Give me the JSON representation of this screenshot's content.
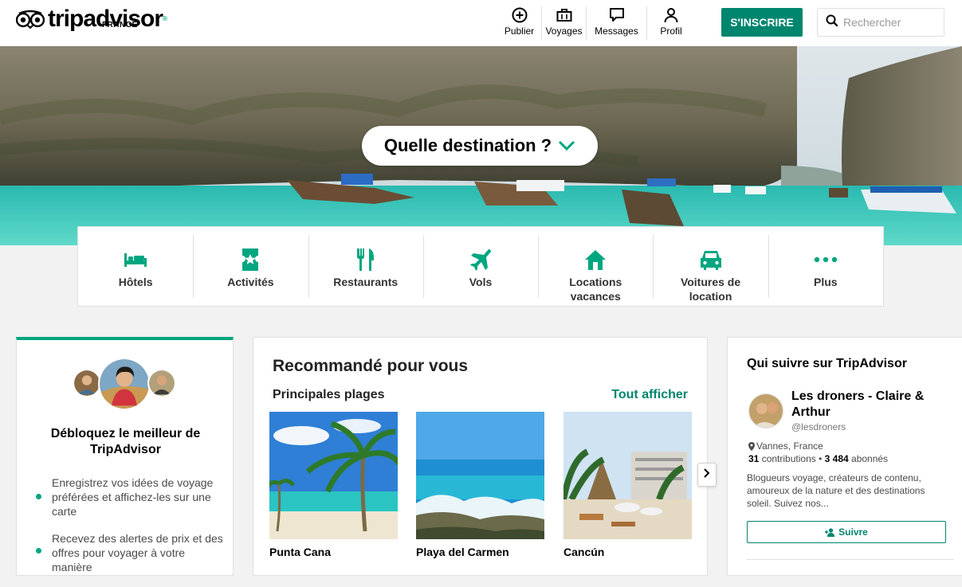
{
  "brand": {
    "name": "tripadvisor",
    "registered": "®",
    "country": "FRANCE",
    "accent": "#00a680",
    "button_color": "#00856f"
  },
  "nav": {
    "publish": "Publier",
    "trips": "Voyages",
    "messages": "Messages",
    "profile": "Profil",
    "signup": "S'INSCRIRE",
    "search_placeholder": "Rechercher"
  },
  "hero": {
    "prompt": "Quelle destination ?"
  },
  "categories": [
    {
      "label": "Hôtels",
      "icon": "bed-icon"
    },
    {
      "label": "Activités",
      "icon": "ticket-icon"
    },
    {
      "label": "Restaurants",
      "icon": "fork-knife-icon"
    },
    {
      "label": "Vols",
      "icon": "plane-icon"
    },
    {
      "label": "Locations vacances",
      "icon": "house-icon"
    },
    {
      "label": "Voitures de location",
      "icon": "car-icon"
    },
    {
      "label": "Plus",
      "icon": "more-icon"
    }
  ],
  "unlock": {
    "title": "Débloquez le meilleur de TripAdvisor",
    "benefits": [
      "Enregistrez vos idées de voyage préférées et affichez-les sur une carte",
      "Recevez des alertes de prix et des offres pour voyager à votre manière"
    ]
  },
  "recommended": {
    "title": "Recommandé pour vous",
    "subtitle": "Principales plages",
    "see_all": "Tout afficher",
    "beaches": [
      {
        "name": "Punta Cana"
      },
      {
        "name": "Playa del Carmen"
      },
      {
        "name": "Cancún"
      }
    ]
  },
  "follow": {
    "title": "Qui suivre sur TripAdvisor",
    "profile": {
      "name": "Les droners - Claire & Arthur",
      "handle": "@lesdroners",
      "location": "Vannes, France",
      "contributions": "31",
      "contributions_label": "contributions",
      "separator": "•",
      "followers": "3 484",
      "followers_label": "abonnés",
      "bio": "Blogueurs voyage, créateurs de contenu, amoureux de la nature et des destinations soleil. Suivez nos..."
    },
    "follow_label": "Suivre"
  }
}
